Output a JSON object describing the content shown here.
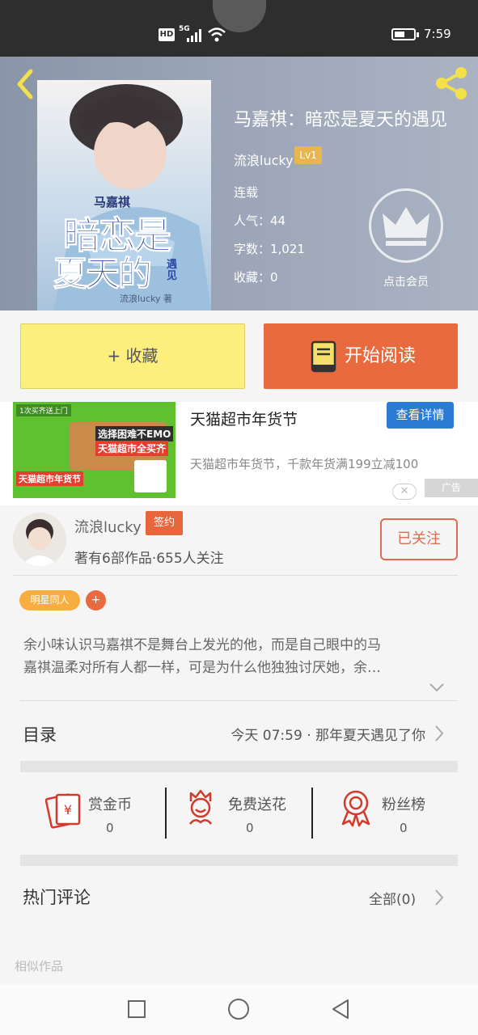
{
  "status_bar": {
    "network_hd": "HD",
    "network_gen": "5G",
    "battery_level": 0.55,
    "time": "7:59"
  },
  "book": {
    "title": "马嘉祺：暗恋是夏天的遇见",
    "author": "流浪lucky",
    "author_level": "Lv1",
    "status": "连载",
    "popularity": "人气：44",
    "word_count": "字数：1,021",
    "favorites": "收藏：0",
    "vip_label": "点击会员",
    "cover": {
      "top_name": "马嘉祺",
      "title_line1": "暗恋是",
      "title_line2": "夏天的",
      "title_suffix": "遇见",
      "author_credit": "流浪lucky 著"
    }
  },
  "actions": {
    "favorite_label": "+ 收藏",
    "read_label": "开始阅读"
  },
  "ad": {
    "title": "天猫超市年货节",
    "button": "查看详情",
    "description": "天猫超市年货节，千款年货满199立减100",
    "tag": "广告",
    "image_badge": "1次买齐送上门",
    "image_headline1": "选择困难不EMO",
    "image_headline2": "天猫超市全买齐",
    "image_footer": "天猫超市年货节"
  },
  "author_card": {
    "name": "流浪lucky",
    "sign_badge": "签约",
    "stats": "著有6部作品·655人关注",
    "follow_label": "已关注"
  },
  "tags": {
    "tag1": "明星同人",
    "add": "+"
  },
  "synopsis": {
    "line1": "余小味认识马嘉祺不是舞台上发光的他，而是自己眼中的马",
    "line2": "嘉祺温柔对所有人都一样，可是为什么他独独讨厌她，余…"
  },
  "toc": {
    "label": "目录",
    "latest": "今天 07:59 · 那年夏天遇见了你"
  },
  "stats": [
    {
      "label": "赏金币",
      "count": "0",
      "icon": "red-envelope-icon"
    },
    {
      "label": "免费送花",
      "count": "0",
      "icon": "flower-icon"
    },
    {
      "label": "粉丝榜",
      "count": "0",
      "icon": "medal-icon"
    }
  ],
  "comments": {
    "label": "热门评论",
    "all_label": "全部(0)"
  },
  "similar_label": "相似作品",
  "colors": {
    "accent_orange": "#e96a3f",
    "favorite_yellow": "#fcef7e",
    "ad_blue": "#2b7ad3",
    "level_gold": "#e8b650"
  }
}
